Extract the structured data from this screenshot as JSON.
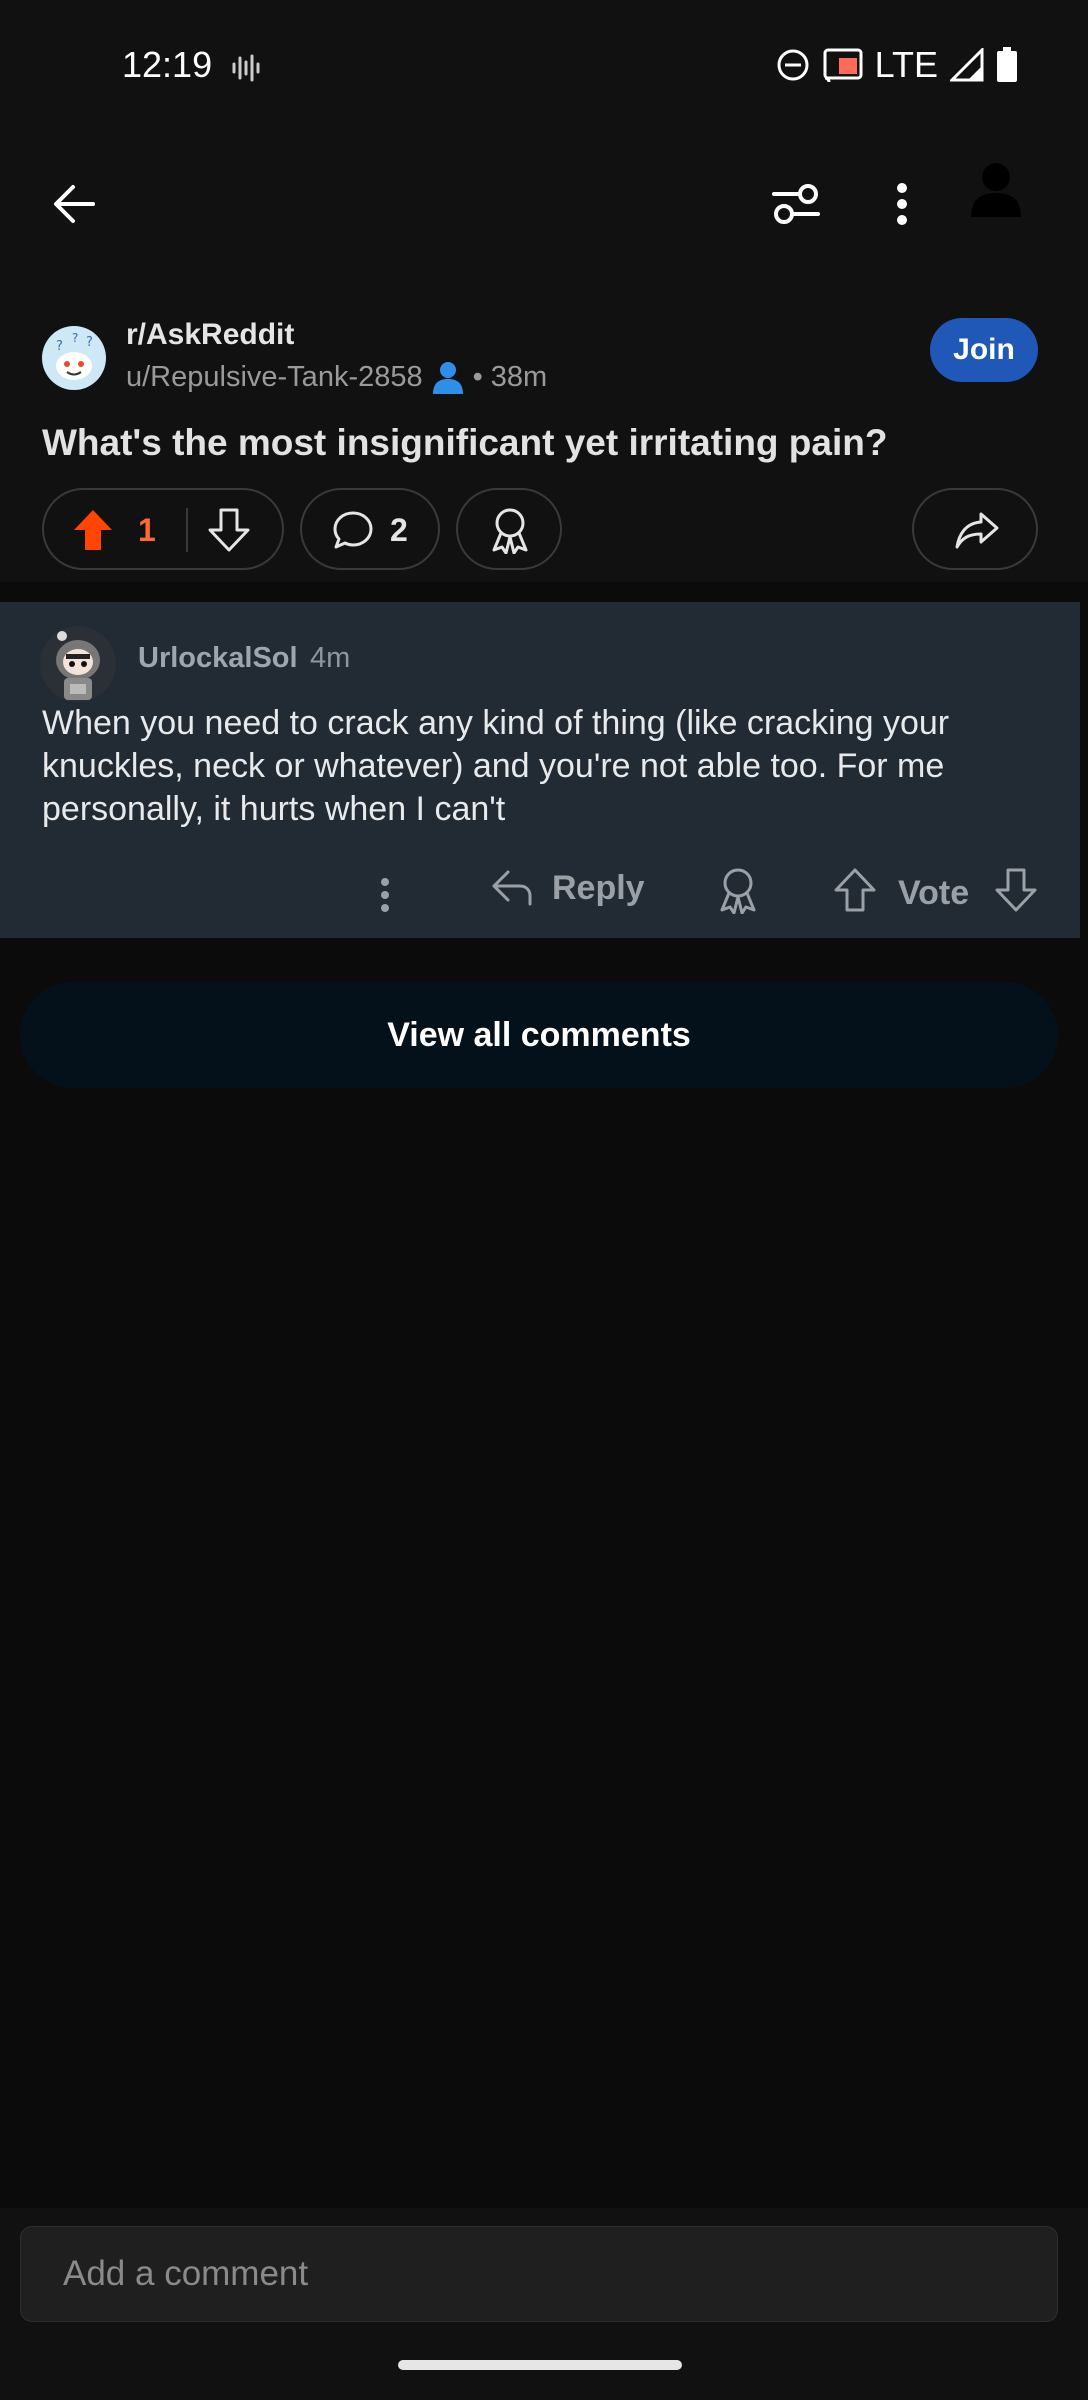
{
  "status": {
    "time": "12:19",
    "network": "LTE"
  },
  "post": {
    "subreddit": "r/AskReddit",
    "author": "u/Repulsive-Tank-2858",
    "age": "38m",
    "join_label": "Join",
    "title": "What's the most insignificant yet irritating pain?",
    "score": "1",
    "comment_count": "2"
  },
  "comment": {
    "author": "UrlockalSol",
    "age": "4m",
    "body": "When you need to crack any kind of thing (like cracking your knuckles, neck or whatever) and you're not able too. For me personally, it hurts when I can't",
    "reply_label": "Reply",
    "vote_label": "Vote"
  },
  "view_all_label": "View all comments",
  "composer": {
    "placeholder": "Add a comment"
  },
  "colors": {
    "upvote": "#ff4500",
    "join": "#1f58b6",
    "comment_bg": "#222a33"
  },
  "icons": [
    "back-arrow-icon",
    "filter-icon",
    "more-vertical-icon",
    "profile-icon",
    "upvote-icon",
    "downvote-icon",
    "comment-bubble-icon",
    "award-icon",
    "share-icon",
    "reply-icon",
    "person-icon"
  ]
}
